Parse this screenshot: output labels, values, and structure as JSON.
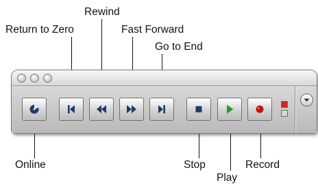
{
  "callouts": {
    "return_to_zero": "Return to Zero",
    "rewind": "Rewind",
    "fast_forward": "Fast Forward",
    "go_to_end": "Go to End",
    "online": "Online",
    "stop": "Stop",
    "play": "Play",
    "record": "Record"
  },
  "icons": {
    "online": "online-clock-icon",
    "return_to_zero": "return-to-zero-icon",
    "rewind": "rewind-icon",
    "fast_forward": "fast-forward-icon",
    "go_to_end": "go-to-end-icon",
    "stop": "stop-icon",
    "play": "play-icon",
    "record": "record-icon",
    "collapse": "chevron-down-icon"
  },
  "colors": {
    "transport_icon": "#1f3a64",
    "play": "#2a9a2a",
    "record": "#c21010",
    "record_lamp_on": "#e81c1c"
  }
}
